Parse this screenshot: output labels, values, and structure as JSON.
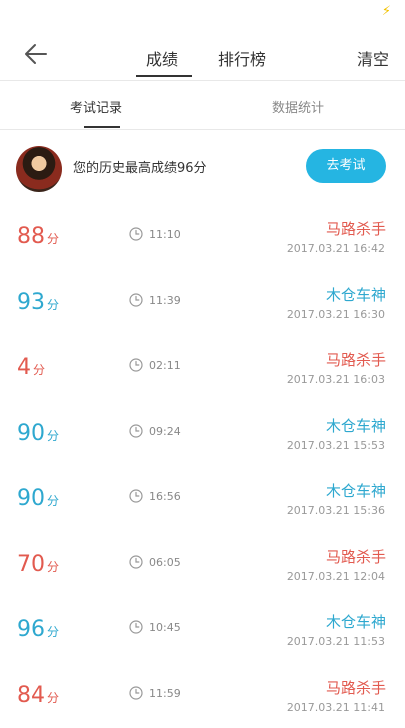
{
  "statusbar": {
    "icon": "lightning-bolt-icon"
  },
  "header": {
    "tabs": [
      "成绩",
      "排行榜"
    ],
    "clear_label": "清空"
  },
  "subtabs": [
    "考试记录",
    "数据统计"
  ],
  "best": {
    "text": "您的历史最高成绩96分",
    "button": "去考试"
  },
  "records": [
    {
      "score": "88",
      "unit": "分",
      "duration": "11:10",
      "title": "马路杀手",
      "date": "2017.03.21 16:42",
      "color": "#e25a4f"
    },
    {
      "score": "93",
      "unit": "分",
      "duration": "11:39",
      "title": "木仓车神",
      "date": "2017.03.21 16:30",
      "color": "#2ea8cf"
    },
    {
      "score": "4",
      "unit": "分",
      "duration": "02:11",
      "title": "马路杀手",
      "date": "2017.03.21 16:03",
      "color": "#e25a4f"
    },
    {
      "score": "90",
      "unit": "分",
      "duration": "09:24",
      "title": "木仓车神",
      "date": "2017.03.21 15:53",
      "color": "#2ea8cf"
    },
    {
      "score": "90",
      "unit": "分",
      "duration": "16:56",
      "title": "木仓车神",
      "date": "2017.03.21 15:36",
      "color": "#2ea8cf"
    },
    {
      "score": "70",
      "unit": "分",
      "duration": "06:05",
      "title": "马路杀手",
      "date": "2017.03.21 12:04",
      "color": "#e25a4f"
    },
    {
      "score": "96",
      "unit": "分",
      "duration": "10:45",
      "title": "木仓车神",
      "date": "2017.03.21 11:53",
      "color": "#2ea8cf"
    },
    {
      "score": "84",
      "unit": "分",
      "duration": "11:59",
      "title": "马路杀手",
      "date": "2017.03.21 11:41",
      "color": "#e25a4f"
    }
  ]
}
